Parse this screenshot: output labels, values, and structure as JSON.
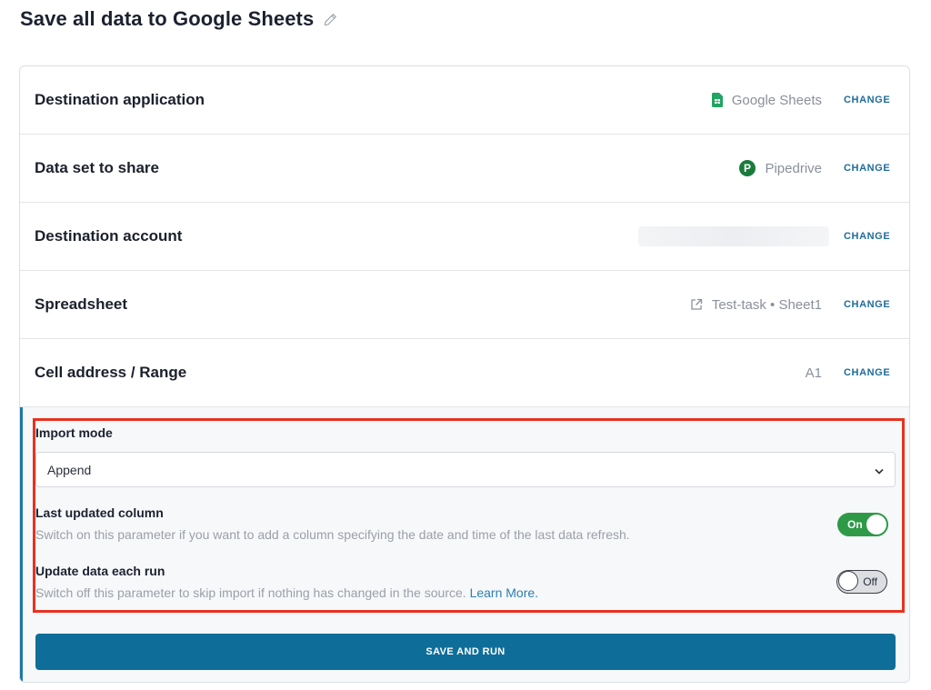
{
  "page": {
    "title": "Save all data to Google Sheets"
  },
  "rows": [
    {
      "label": "Destination application",
      "value": "Google Sheets",
      "icon": "google-sheets-icon",
      "change": "CHANGE"
    },
    {
      "label": "Data set to share",
      "value": "Pipedrive",
      "icon": "pipedrive-icon",
      "change": "CHANGE"
    },
    {
      "label": "Destination account",
      "value": "",
      "change": "CHANGE"
    },
    {
      "label": "Spreadsheet",
      "value": "Test-task • Sheet1",
      "icon": "external-link-icon",
      "change": "CHANGE"
    },
    {
      "label": "Cell address / Range",
      "value": "A1",
      "change": "CHANGE"
    }
  ],
  "settings": {
    "import_mode_label": "Import mode",
    "import_mode_value": "Append",
    "last_updated": {
      "title": "Last updated column",
      "description": "Switch on this parameter if you want to add a column specifying the date and time of the last data refresh.",
      "toggle_label": "On",
      "enabled": true
    },
    "update_each_run": {
      "title": "Update data each run",
      "description": "Switch off this parameter to skip import if nothing has changed in the source.",
      "learn_more": "Learn More.",
      "toggle_label": "Off",
      "enabled": false
    }
  },
  "save_button": "SAVE AND RUN",
  "colors": {
    "accent": "#0f6e99",
    "link": "#1f6c9c",
    "toggle_on": "#2e9a48",
    "highlight": "#e8321f",
    "google_sheets": "#21a464",
    "pipedrive": "#1a7a3c"
  }
}
